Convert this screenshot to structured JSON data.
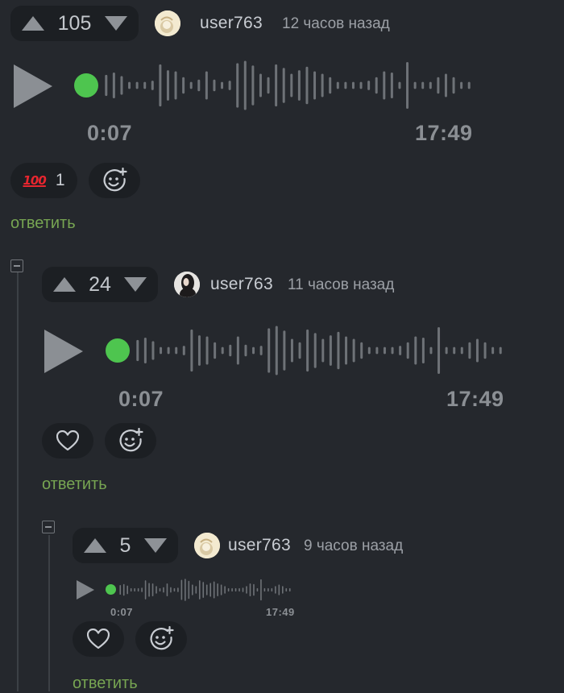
{
  "comments": [
    {
      "score": "105",
      "username": "user763",
      "time": "12 часов назад",
      "audio": {
        "current": "0:07",
        "total": "17:49"
      },
      "reaction": {
        "emoji": "💯",
        "count": "1"
      },
      "reply": "ответить"
    },
    {
      "score": "24",
      "username": "user763",
      "time": "11 часов назад",
      "audio": {
        "current": "0:07",
        "total": "17:49"
      },
      "reply": "ответить"
    },
    {
      "score": "5",
      "username": "user763",
      "time": "9 часов назад",
      "audio": {
        "current": "0:07",
        "total": "17:49"
      },
      "reply": "ответить"
    }
  ],
  "icons": {
    "vote_up": "arrow-up-icon",
    "vote_down": "arrow-down-icon",
    "play": "play-icon",
    "like": "heart-icon",
    "add_reaction": "add-reaction-icon",
    "collapse": "collapse-icon"
  },
  "colors": {
    "background": "#25282d",
    "pill": "#1c1f23",
    "accent_green": "#4ec54f",
    "reply_green": "#77a552",
    "reaction_red": "#e8262f"
  }
}
